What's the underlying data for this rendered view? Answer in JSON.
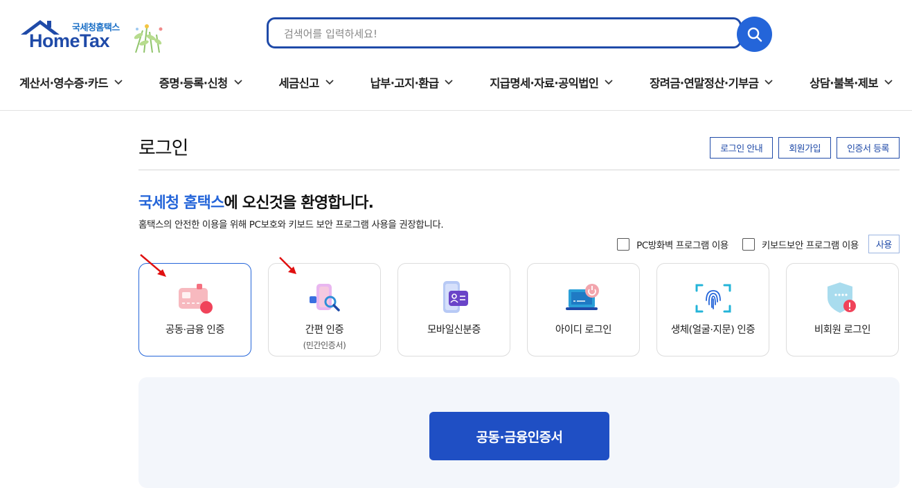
{
  "logo": {
    "sub": "국세청홈택스",
    "main": "HomeTax"
  },
  "search": {
    "placeholder": "검색어를 입력하세요!"
  },
  "gnb": [
    {
      "label": "계산서·영수증·카드"
    },
    {
      "label": "증명·등록·신청"
    },
    {
      "label": "세금신고"
    },
    {
      "label": "납부·고지·환급"
    },
    {
      "label": "지급명세·자료·공익법인"
    },
    {
      "label": "장려금·연말정산·기부금"
    },
    {
      "label": "상담·불복·제보"
    }
  ],
  "page": {
    "title": "로그인",
    "buttons": [
      "로그인 안내",
      "회원가입",
      "인증서 등록"
    ]
  },
  "welcome": {
    "brand": "국세청 홈택스",
    "rest": "에 오신것을 환영합니다.",
    "sub": "홈택스의 안전한 이용을 위해 PC보호와 키보드 보안 프로그램 사용을 권장합니다."
  },
  "security": {
    "firewall_label": "PC방화벽 프로그램 이용",
    "keyboard_label": "키보드보안 프로그램 이용",
    "use_button": "사용"
  },
  "login_methods": [
    {
      "label": "공동·금융 인증",
      "sub": "",
      "icon": "certificate-card-icon",
      "active": true
    },
    {
      "label": "간편 인증",
      "sub": "(민간인증서)",
      "icon": "simple-auth-icon",
      "active": false
    },
    {
      "label": "모바일신분증",
      "sub": "",
      "icon": "mobile-id-icon",
      "active": false
    },
    {
      "label": "아이디 로그인",
      "sub": "",
      "icon": "id-laptop-icon",
      "active": false
    },
    {
      "label": "생체(얼굴·지문) 인증",
      "sub": "",
      "icon": "fingerprint-icon",
      "active": false
    },
    {
      "label": "비회원 로그인",
      "sub": "",
      "icon": "shield-guest-icon",
      "active": false
    }
  ],
  "panel": {
    "button_label": "공동·금융인증서"
  },
  "colors": {
    "brand_blue": "#1f4aa8",
    "accent_blue": "#2465d9",
    "arrow_red": "#e01010"
  }
}
